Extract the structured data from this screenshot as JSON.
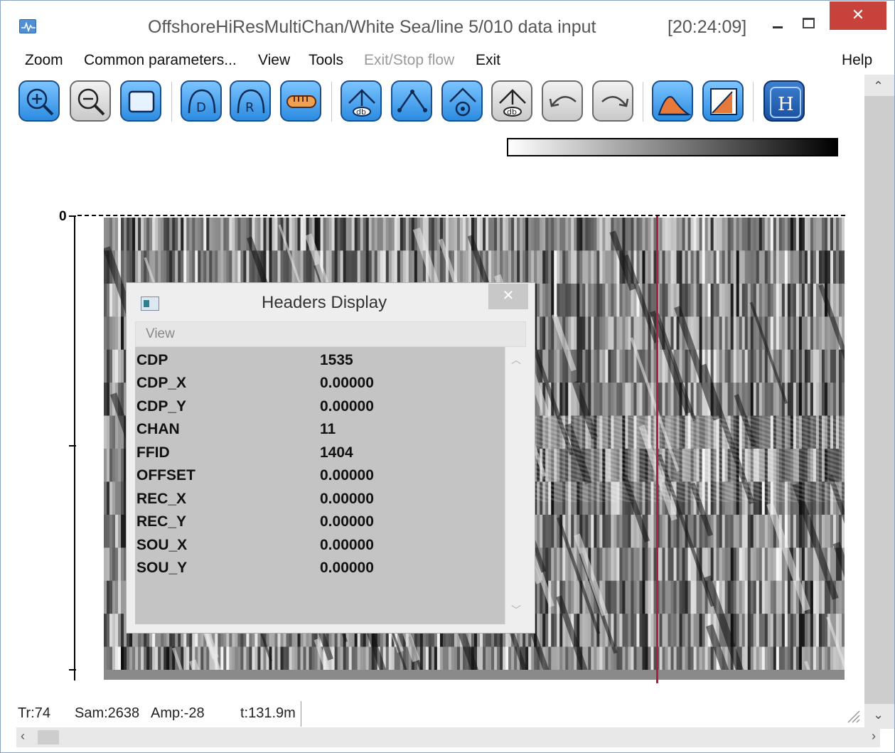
{
  "window": {
    "title": "OffshoreHiResMultiChan/White Sea/line 5/010 data input",
    "time": "[20:24:09]",
    "close_glyph": "✕"
  },
  "menu": {
    "zoom": "Zoom",
    "common": "Common parameters...",
    "view": "View",
    "tools": "Tools",
    "exit_stop": "Exit/Stop flow",
    "exit": "Exit",
    "help": "Help"
  },
  "toolbar": {
    "buttons": [
      {
        "name": "zoom-in-icon"
      },
      {
        "name": "zoom-out-icon"
      },
      {
        "name": "zoom-fit-icon"
      },
      {
        "name": "d-tool-icon",
        "label": "D"
      },
      {
        "name": "r-tool-icon",
        "label": "R"
      },
      {
        "name": "ruler-icon"
      },
      {
        "name": "pick-db-icon",
        "label": "db"
      },
      {
        "name": "pick-line-icon"
      },
      {
        "name": "pick-settings-icon"
      },
      {
        "name": "save-pick-db-icon",
        "label": "db"
      },
      {
        "name": "undo-icon"
      },
      {
        "name": "redo-icon"
      },
      {
        "name": "amplitude-spectrum-icon"
      },
      {
        "name": "fk-spectrum-icon"
      },
      {
        "name": "headers-icon",
        "label": "H"
      }
    ]
  },
  "plot": {
    "axis_zero_label": "0",
    "color_scale": {
      "from": "#ffffff",
      "to": "#000000"
    },
    "cursor_color": "#b01f3c"
  },
  "headers_dialog": {
    "title": "Headers Display",
    "menu_view": "View",
    "close_glyph": "✕",
    "rows": [
      {
        "key": "CDP",
        "value": "1535"
      },
      {
        "key": "CDP_X",
        "value": "0.00000"
      },
      {
        "key": "CDP_Y",
        "value": "0.00000"
      },
      {
        "key": "CHAN",
        "value": "11"
      },
      {
        "key": "FFID",
        "value": "1404"
      },
      {
        "key": "OFFSET",
        "value": "0.00000"
      },
      {
        "key": "REC_X",
        "value": "0.00000"
      },
      {
        "key": "REC_Y",
        "value": "0.00000"
      },
      {
        "key": "SOU_X",
        "value": "0.00000"
      },
      {
        "key": "SOU_Y",
        "value": "0.00000"
      }
    ]
  },
  "status": {
    "tr": "Tr:74",
    "sam": "Sam:2638",
    "amp": "Amp:-28",
    "t": "t:131.9m"
  }
}
